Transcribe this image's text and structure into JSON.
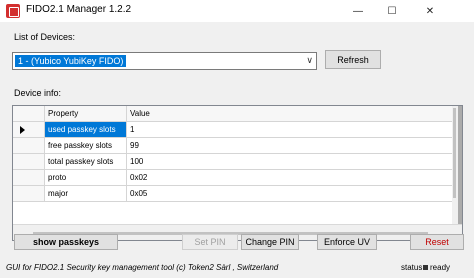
{
  "window": {
    "title": "FIDO2.1 Manager 1.2.2",
    "minimize": "—",
    "maximize": "☐",
    "close": "✕"
  },
  "devices": {
    "label": "List of Devices:",
    "selected": "1 - (Yubico YubiKey FIDO)",
    "dropdown_arrow": "∨",
    "refresh_label": "Refresh"
  },
  "device_info": {
    "label": "Device info:",
    "columns": [
      "Property",
      "Value"
    ],
    "rows": [
      {
        "property": "used passkey slots",
        "value": "1"
      },
      {
        "property": "free passkey slots",
        "value": "99"
      },
      {
        "property": "total passkey slots",
        "value": "100"
      },
      {
        "property": "proto",
        "value": "0x02"
      },
      {
        "property": "major",
        "value": "0x05"
      }
    ]
  },
  "actions": {
    "show_passkeys": "show passkeys",
    "set_pin": "Set PIN",
    "change_pin": "Change PIN",
    "enforce_uv": "Enforce UV",
    "reset": "Reset"
  },
  "status": {
    "credit": "GUI for FIDO2.1 Security key management tool (c) Token2 Sàrl , Switzerland",
    "label": "status:",
    "value": "ready"
  }
}
